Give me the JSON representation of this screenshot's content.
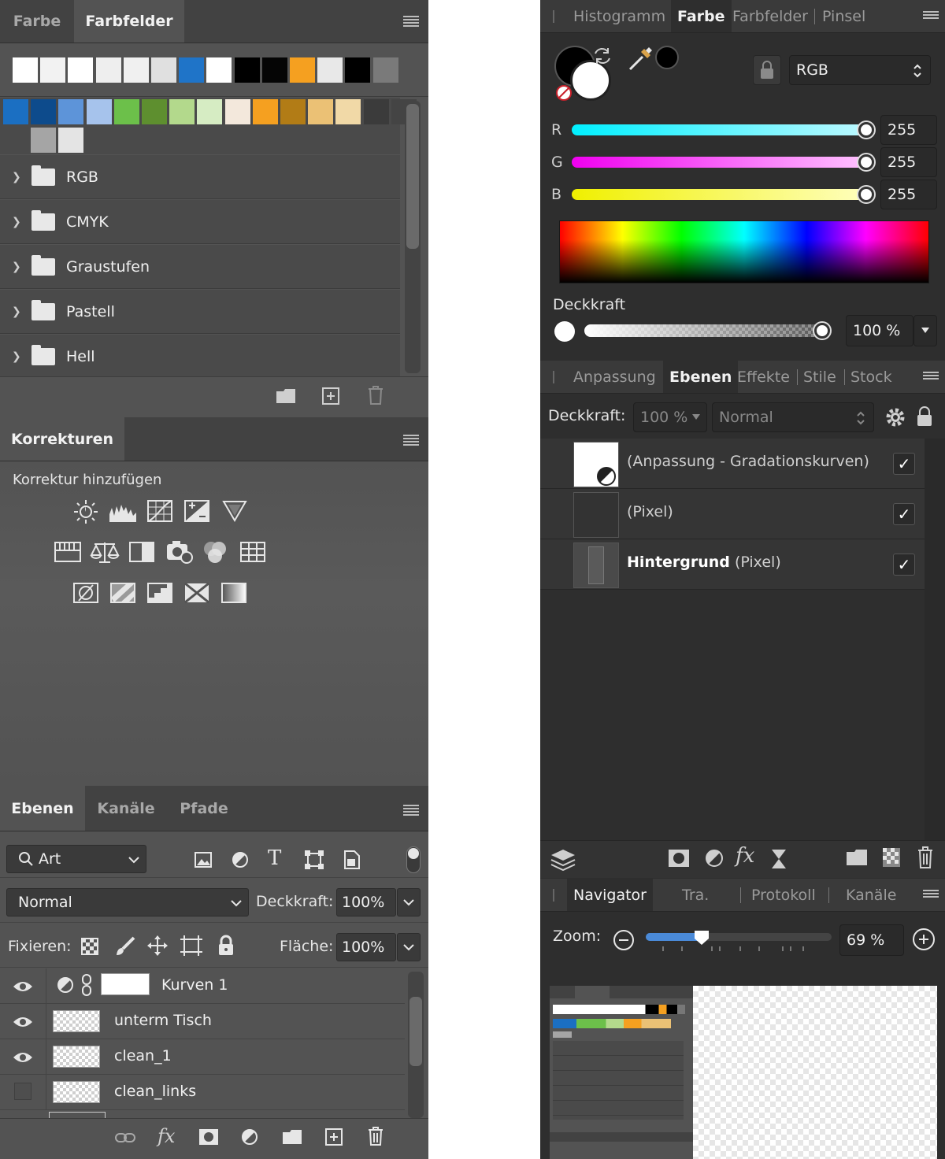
{
  "left": {
    "swatches_panel": {
      "tabs": [
        "Farbe",
        "Farbfelder"
      ],
      "recent_swatches": [
        "#ffffff",
        "#f2f2f2",
        "#ffffff",
        "#eeeeee",
        "#f0f0f0",
        "#e0e0e0",
        "#1f74c8",
        "#ffffff",
        "#000000",
        "#050505",
        "#f5a020",
        "#e8e8e8",
        "#000000",
        "#7a7a7a"
      ],
      "preset_swatches": [
        "#1b6fc2",
        "#0d4b8c",
        "#5d94d9",
        "#a6c3ec",
        "#6cc04a",
        "#5e8f2f",
        "#b3d98c",
        "#d6ecc3",
        "#f3e8dc",
        "#f5a020",
        "#b27c16",
        "#ebc175",
        "#f1d9a7",
        "#3b3b3b",
        "#444444",
        "#a5a5a5",
        "#e4e4e4"
      ],
      "folders": [
        "RGB",
        "CMYK",
        "Graustufen",
        "Pastell",
        "Hell"
      ]
    },
    "corrections_panel": {
      "tab": "Korrekturen",
      "add_label": "Korrektur hinzufügen"
    },
    "layers_panel": {
      "tabs": [
        "Ebenen",
        "Kanäle",
        "Pfade"
      ],
      "filter_label": "Art",
      "blend_mode": "Normal",
      "opacity_label": "Deckkraft:",
      "opacity_value": "100%",
      "lock_label": "Fixieren:",
      "fill_label": "Fläche:",
      "fill_value": "100%",
      "layers": [
        {
          "name": "Kurven 1",
          "visible": true
        },
        {
          "name": "unterm Tisch",
          "visible": true
        },
        {
          "name": "clean_1",
          "visible": true
        },
        {
          "name": "clean_links",
          "visible": false
        }
      ]
    }
  },
  "right": {
    "color_panel": {
      "tabs": [
        "Histogramm",
        "Farbe",
        "Farbfelder",
        "Pinsel"
      ],
      "mode": "RGB",
      "channels": [
        {
          "label": "R",
          "value": "255"
        },
        {
          "label": "G",
          "value": "255"
        },
        {
          "label": "B",
          "value": "255"
        }
      ],
      "opacity_label": "Deckkraft",
      "opacity_value": "100 %"
    },
    "layers_panel": {
      "tabs": [
        "Anpassung",
        "Ebenen",
        "Effekte",
        "Stile",
        "Stock"
      ],
      "opacity_label": "Deckkraft:",
      "opacity_value": "100 %",
      "blend_mode": "Normal",
      "layers": [
        {
          "name": "",
          "type": "(Anpassung - Gradationskurven)"
        },
        {
          "name": "",
          "type": "(Pixel)"
        },
        {
          "name": "Hintergrund",
          "type": "(Pixel)"
        }
      ]
    },
    "navigator_panel": {
      "tabs": [
        "Navigator",
        "Tra.",
        "Protokoll",
        "Kanäle"
      ],
      "zoom_label": "Zoom:",
      "zoom_value": "69 %"
    }
  }
}
